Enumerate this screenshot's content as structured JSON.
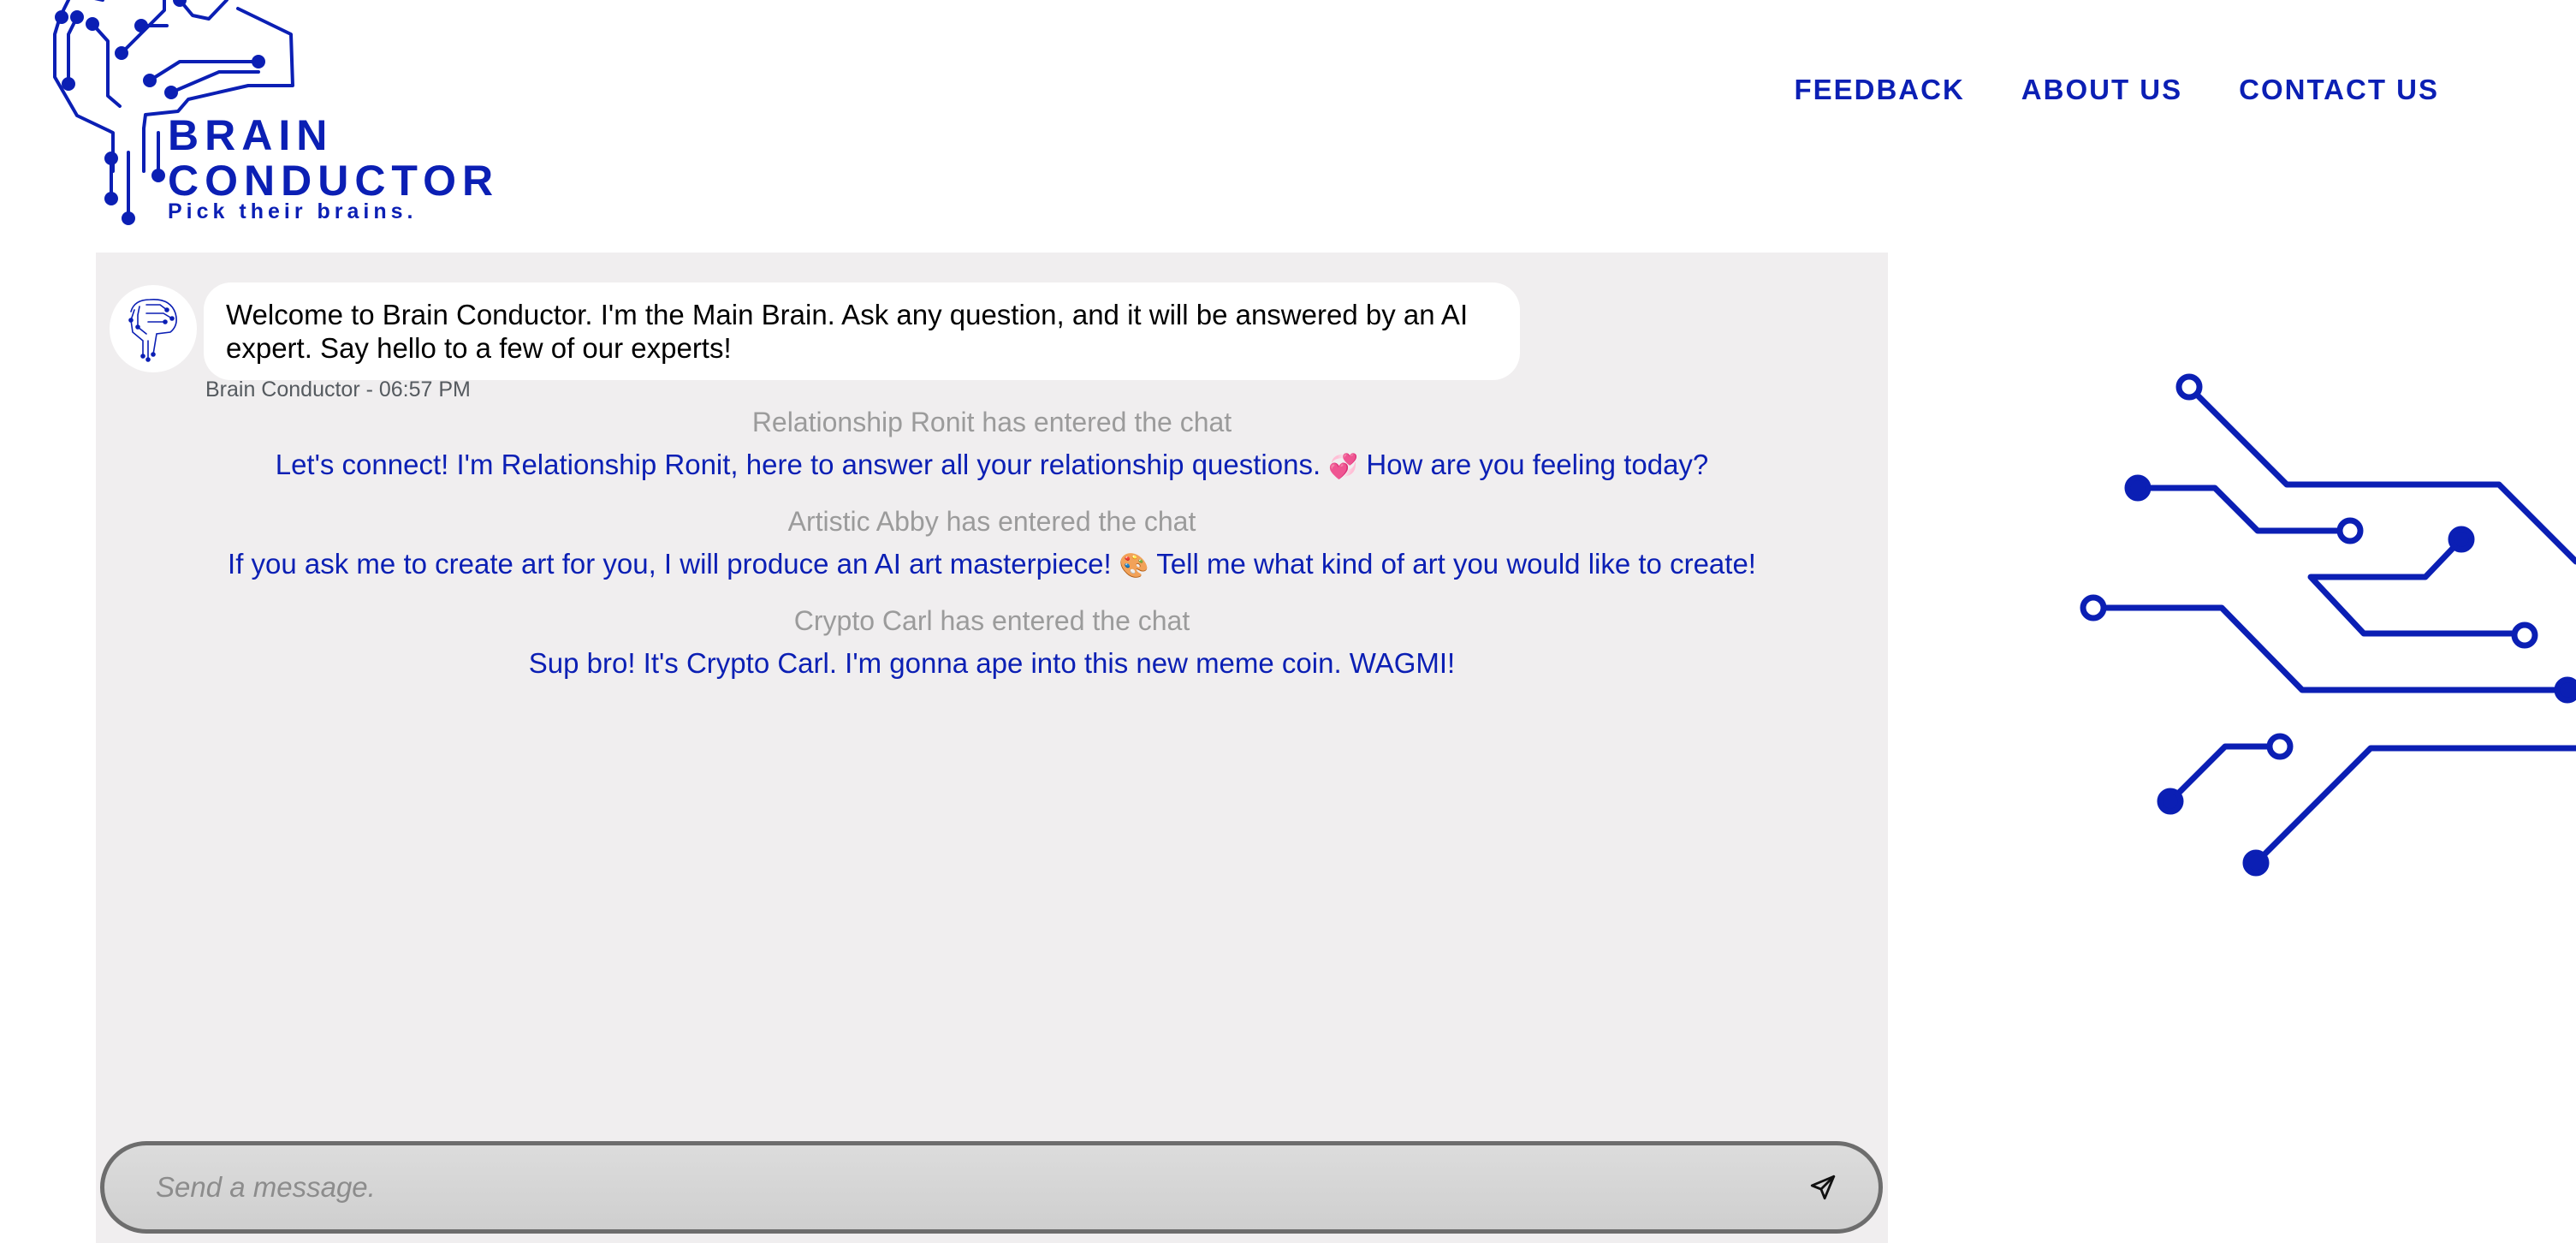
{
  "brand": {
    "title_line1": "BRAIN",
    "title_line2": "CONDUCTOR",
    "tagline": "Pick their brains.",
    "color": "#0b1fb4"
  },
  "nav": {
    "items": [
      {
        "label": "FEEDBACK"
      },
      {
        "label": "ABOUT US"
      },
      {
        "label": "CONTACT US"
      }
    ]
  },
  "chat": {
    "welcome": {
      "text": "Welcome to Brain Conductor. I'm the Main Brain. Ask any question, and it will be answered by an AI expert. Say hello to a few of our experts!",
      "meta": "Brain Conductor - 06:57 PM",
      "avatar_icon": "brain-circuit-icon"
    },
    "events": [
      {
        "notice": "Relationship Ronit has entered the chat",
        "message_before": "Let's connect! I'm Relationship Ronit, here to answer all your relationship questions.",
        "emoji": "💞",
        "message_after": "How are you feeling today?"
      },
      {
        "notice": "Artistic Abby has entered the chat",
        "message_before": "If you ask me to create art for you, I will produce an AI art masterpiece!",
        "emoji": "🎨",
        "message_after": "Tell me what kind of art you would like to create!"
      },
      {
        "notice": "Crypto Carl has entered the chat",
        "message_before": "Sup bro! It's Crypto Carl. I'm gonna ape into this new meme coin. WAGMI!",
        "emoji": "",
        "message_after": ""
      }
    ]
  },
  "composer": {
    "placeholder": "Send a message.",
    "send_icon": "send-icon"
  },
  "colors": {
    "accent": "#0b1fb4",
    "panel_bg": "#f0eeef",
    "notice": "#9b9b9b"
  }
}
